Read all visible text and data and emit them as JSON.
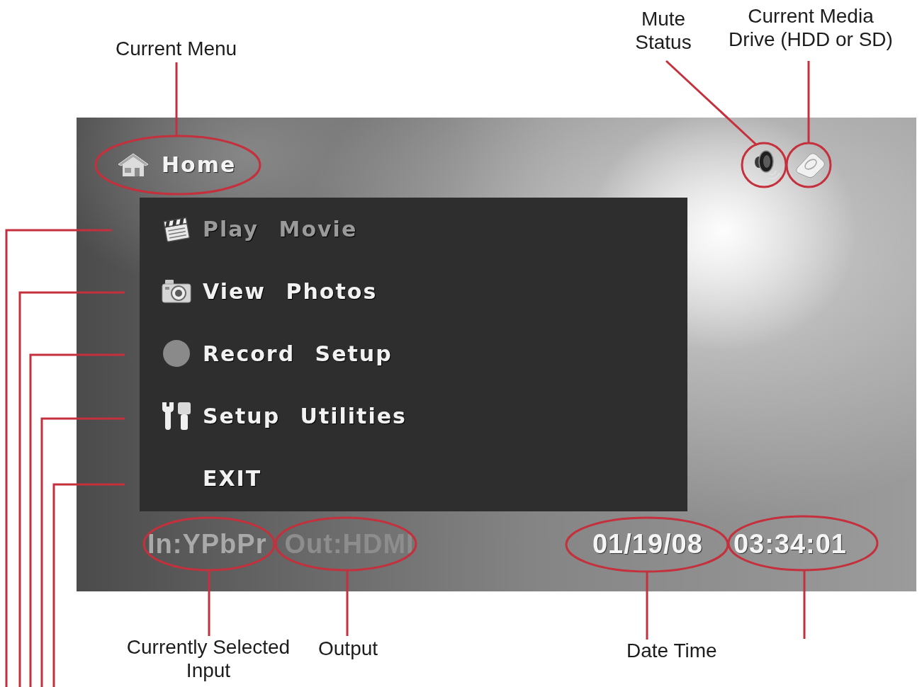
{
  "screen": {
    "menu_title": "Home",
    "menu": [
      {
        "label": "Play Movie",
        "disabled": true
      },
      {
        "label": "View Photos",
        "disabled": false
      },
      {
        "label": "Record Setup",
        "disabled": false
      },
      {
        "label": "Setup Utilities",
        "disabled": false
      },
      {
        "label": "EXIT",
        "disabled": false
      }
    ],
    "status": {
      "input": "In:YPbPr",
      "output": "Out:HDMI",
      "date": "01/19/08",
      "time": "03:34:01"
    }
  },
  "callouts": [
    {
      "label": "Current Menu"
    },
    {
      "label": "Mute Status"
    },
    {
      "label": "Current Media Drive (HDD or SD)"
    },
    {
      "label": "Currently Selected Input"
    },
    {
      "label": "Output"
    },
    {
      "label": "Date Time"
    }
  ]
}
